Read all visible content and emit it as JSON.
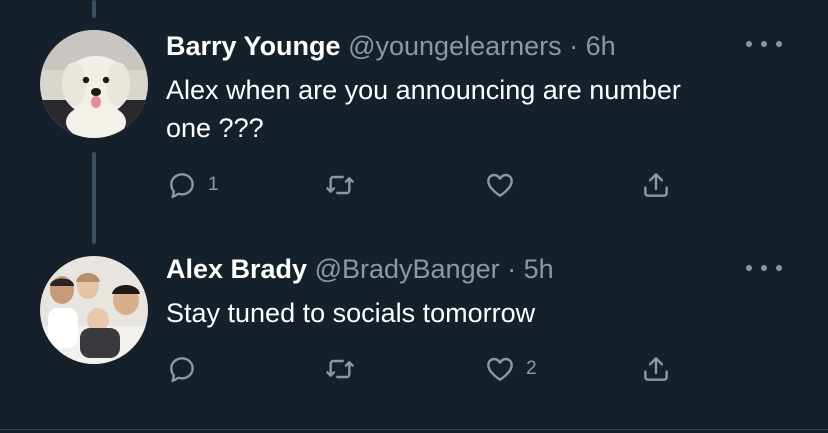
{
  "tweets": [
    {
      "name": "Barry Younge",
      "handle": "@youngelearners",
      "separator": "·",
      "time": "6h",
      "text_line1": "Alex when are you announcing are number",
      "text_line2": "one ???",
      "reply_count": "1",
      "retweet_count": "",
      "like_count": "",
      "avatar_icon": "dog-avatar"
    },
    {
      "name": "Alex Brady",
      "handle": "@BradyBanger",
      "separator": "·",
      "time": "5h",
      "text_line1": "Stay tuned to socials tomorrow",
      "reply_count": "",
      "retweet_count": "",
      "like_count": "2",
      "avatar_icon": "family-avatar"
    }
  ],
  "icons": {
    "reply": "reply-icon",
    "retweet": "retweet-icon",
    "like": "heart-icon",
    "share": "share-icon",
    "more": "more-icon"
  },
  "colors": {
    "background": "#15202b",
    "secondary_text": "#8b98a5",
    "thread_line": "#3d4f61"
  }
}
